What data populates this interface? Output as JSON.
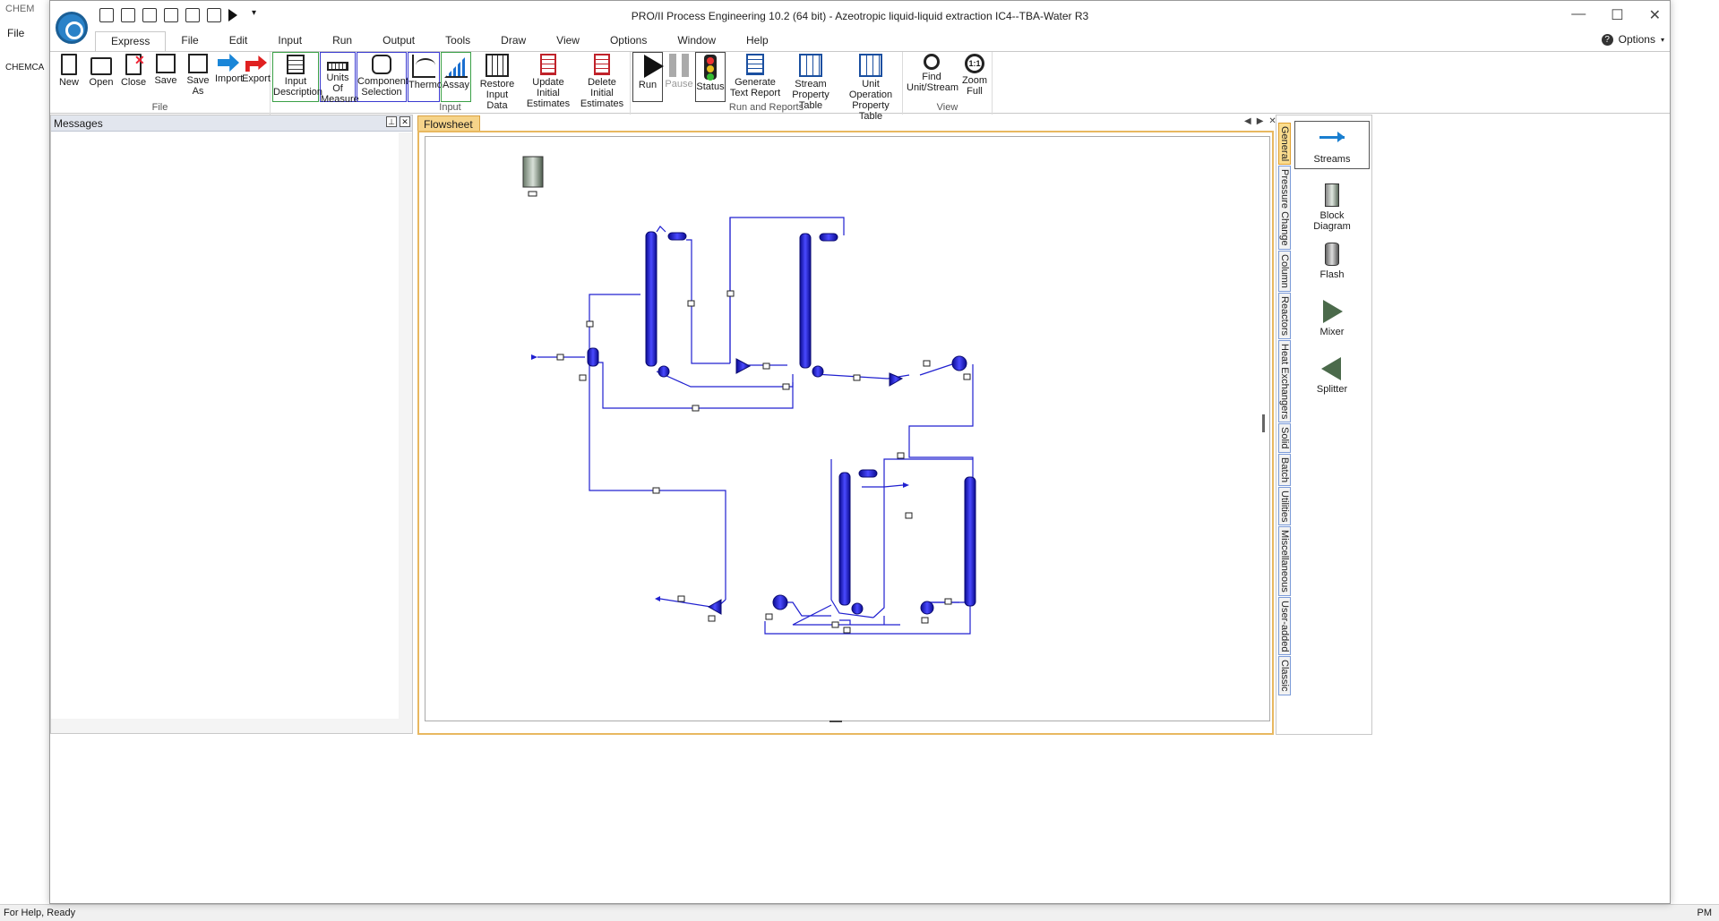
{
  "background_app": {
    "title_fragment": "CHEM",
    "file_label": "File",
    "tree_label": "CHEMCA",
    "status_fragment": "For Help, Ready",
    "bottom_right": "PM"
  },
  "window": {
    "title": "PRO/II Process Engineering 10.2 (64 bit) - Azeotropic liquid-liquid extraction IC4--TBA-Water R3",
    "controls": [
      "—",
      "☐",
      "✕"
    ]
  },
  "ribbon": {
    "tabs": [
      "Express",
      "File",
      "Edit",
      "Input",
      "Run",
      "Output",
      "Tools",
      "Draw",
      "View",
      "Options",
      "Window",
      "Help"
    ],
    "active_tab": "Express",
    "options_label": "Options",
    "groups": {
      "file": {
        "label": "File",
        "buttons": [
          {
            "label": "New",
            "icon": "new-document-icon"
          },
          {
            "label": "Open",
            "icon": "open-folder-icon"
          },
          {
            "label": "Close",
            "icon": "close-document-icon"
          },
          {
            "label": "Save",
            "icon": "save-disk-icon"
          },
          {
            "label": "Save As",
            "icon": "save-as-icon"
          },
          {
            "label": "Import",
            "icon": "import-icon"
          },
          {
            "label": "Export",
            "icon": "export-icon"
          }
        ]
      },
      "input": {
        "label": "Input",
        "buttons": [
          {
            "label": "Input Description",
            "icon": "input-description-icon"
          },
          {
            "label": "Units Of Measure",
            "icon": "ruler-icon"
          },
          {
            "label": "Component Selection",
            "icon": "component-icon"
          },
          {
            "label": "Thermo",
            "icon": "thermo-graph-icon"
          },
          {
            "label": "Assay",
            "icon": "assay-bars-icon"
          },
          {
            "label": "Restore Input Data",
            "icon": "restore-data-icon"
          },
          {
            "label": "Update Initial Estimates",
            "icon": "update-estimates-icon"
          },
          {
            "label": "Delete Initial Estimates",
            "icon": "delete-estimates-icon"
          }
        ]
      },
      "run": {
        "label": "Run and Reports",
        "buttons": [
          {
            "label": "Run",
            "icon": "run-play-icon"
          },
          {
            "label": "Pause",
            "icon": "pause-icon"
          },
          {
            "label": "Status",
            "icon": "traffic-light-icon"
          },
          {
            "label": "Generate Text Report",
            "icon": "text-report-icon"
          },
          {
            "label": "Stream Property Table",
            "icon": "stream-table-icon"
          },
          {
            "label": "Unit Operation Property Table",
            "icon": "unitop-table-icon"
          }
        ]
      },
      "view": {
        "label": "View",
        "buttons": [
          {
            "label": "Find Unit/Stream",
            "icon": "search-icon"
          },
          {
            "label": "Zoom Full",
            "icon": "zoom-full-icon"
          }
        ]
      }
    }
  },
  "messages": {
    "title": "Messages"
  },
  "flowsheet": {
    "tab_label": "Flowsheet"
  },
  "palette": {
    "tabs": [
      "General",
      "Pressure Change",
      "Column",
      "Reactors",
      "Heat Exchangers",
      "Solid",
      "Batch",
      "Utilities",
      "Miscellaneous",
      "User-added",
      "Classic"
    ],
    "active_tab": "General",
    "items": [
      {
        "label": "Streams",
        "icon": "streams-arrow-icon"
      },
      {
        "label": "Block Diagram",
        "icon": "block-diagram-icon"
      },
      {
        "label": "Flash",
        "icon": "flash-drum-icon"
      },
      {
        "label": "Mixer",
        "icon": "mixer-icon"
      },
      {
        "label": "Splitter",
        "icon": "splitter-icon"
      }
    ]
  },
  "colors": {
    "stream_line": "#2020d0",
    "unit_fill": "#1c1cd8",
    "tab_active": "#f6d48a",
    "palette_border": "#7b9bd8"
  }
}
